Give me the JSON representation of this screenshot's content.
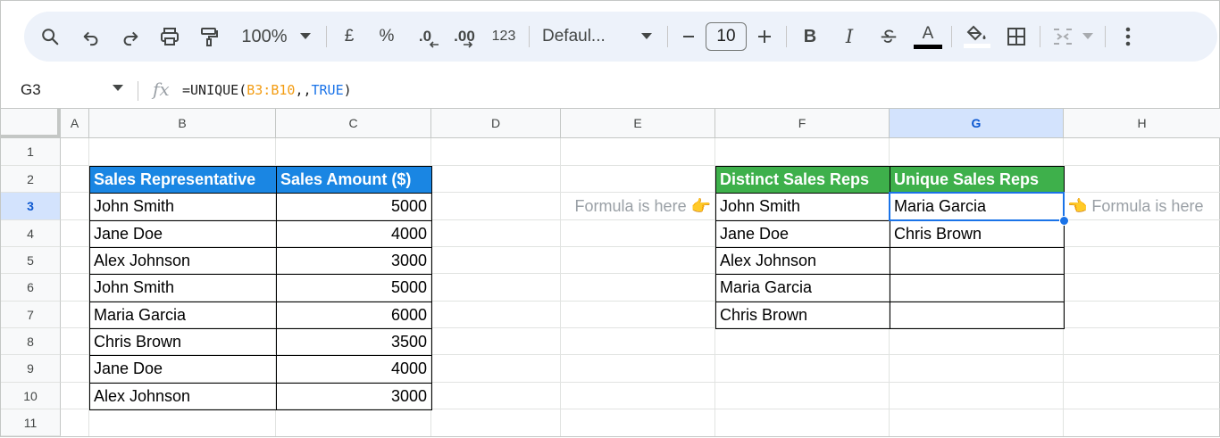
{
  "toolbar": {
    "zoom": "100%",
    "currency": "£",
    "percent": "%",
    "dec_decrease": ".0",
    "dec_increase": ".00",
    "number_format": "123",
    "font": "Defaul...",
    "font_size": "10",
    "bold": "B",
    "italic": "I",
    "text_color": "A",
    "icons": [
      "search-icon",
      "undo-icon",
      "redo-icon",
      "print-icon",
      "paint-format-icon",
      "chevron-down-icon",
      "minus-icon",
      "plus-icon",
      "strikethrough-icon",
      "fill-color-icon",
      "borders-icon",
      "merge-cells-icon",
      "more-vert-icon"
    ]
  },
  "formula_bar": {
    "cell_ref": "G3",
    "fx": "fx",
    "formula_prefix": "=UNIQUE(",
    "formula_range": "B3:B10",
    "formula_mid": ",,",
    "formula_bool": "TRUE",
    "formula_suffix": ")"
  },
  "columns": [
    "A",
    "B",
    "C",
    "D",
    "E",
    "F",
    "G",
    "H"
  ],
  "rows": [
    "1",
    "2",
    "3",
    "4",
    "5",
    "6",
    "7",
    "8",
    "9",
    "10",
    "11"
  ],
  "selected": {
    "column": "G",
    "row": "3"
  },
  "sales_table": {
    "headers": [
      "Sales Representative",
      "Sales Amount ($)"
    ],
    "rows": [
      [
        "John Smith",
        "5000"
      ],
      [
        "Jane Doe",
        "4000"
      ],
      [
        "Alex Johnson",
        "3000"
      ],
      [
        "John Smith",
        "5000"
      ],
      [
        "Maria Garcia",
        "6000"
      ],
      [
        "Chris Brown",
        "3500"
      ],
      [
        "Jane Doe",
        "4000"
      ],
      [
        "Alex Johnson",
        "3000"
      ]
    ]
  },
  "distinct_table": {
    "header": "Distinct Sales Reps",
    "values": [
      "John Smith",
      "Jane Doe",
      "Alex Johnson",
      "Maria Garcia",
      "Chris Brown"
    ]
  },
  "unique_table": {
    "header": "Unique Sales Reps",
    "values": [
      "Maria Garcia",
      "Chris Brown",
      "",
      "",
      ""
    ]
  },
  "notes": {
    "left": "Formula is here 👉",
    "right": "👈 Formula is here"
  },
  "colors": {
    "blue_header": "#1a86e3",
    "green_header": "#3eb04b",
    "selection": "#1a73e8",
    "toolbar_bg": "#edf2fa"
  }
}
